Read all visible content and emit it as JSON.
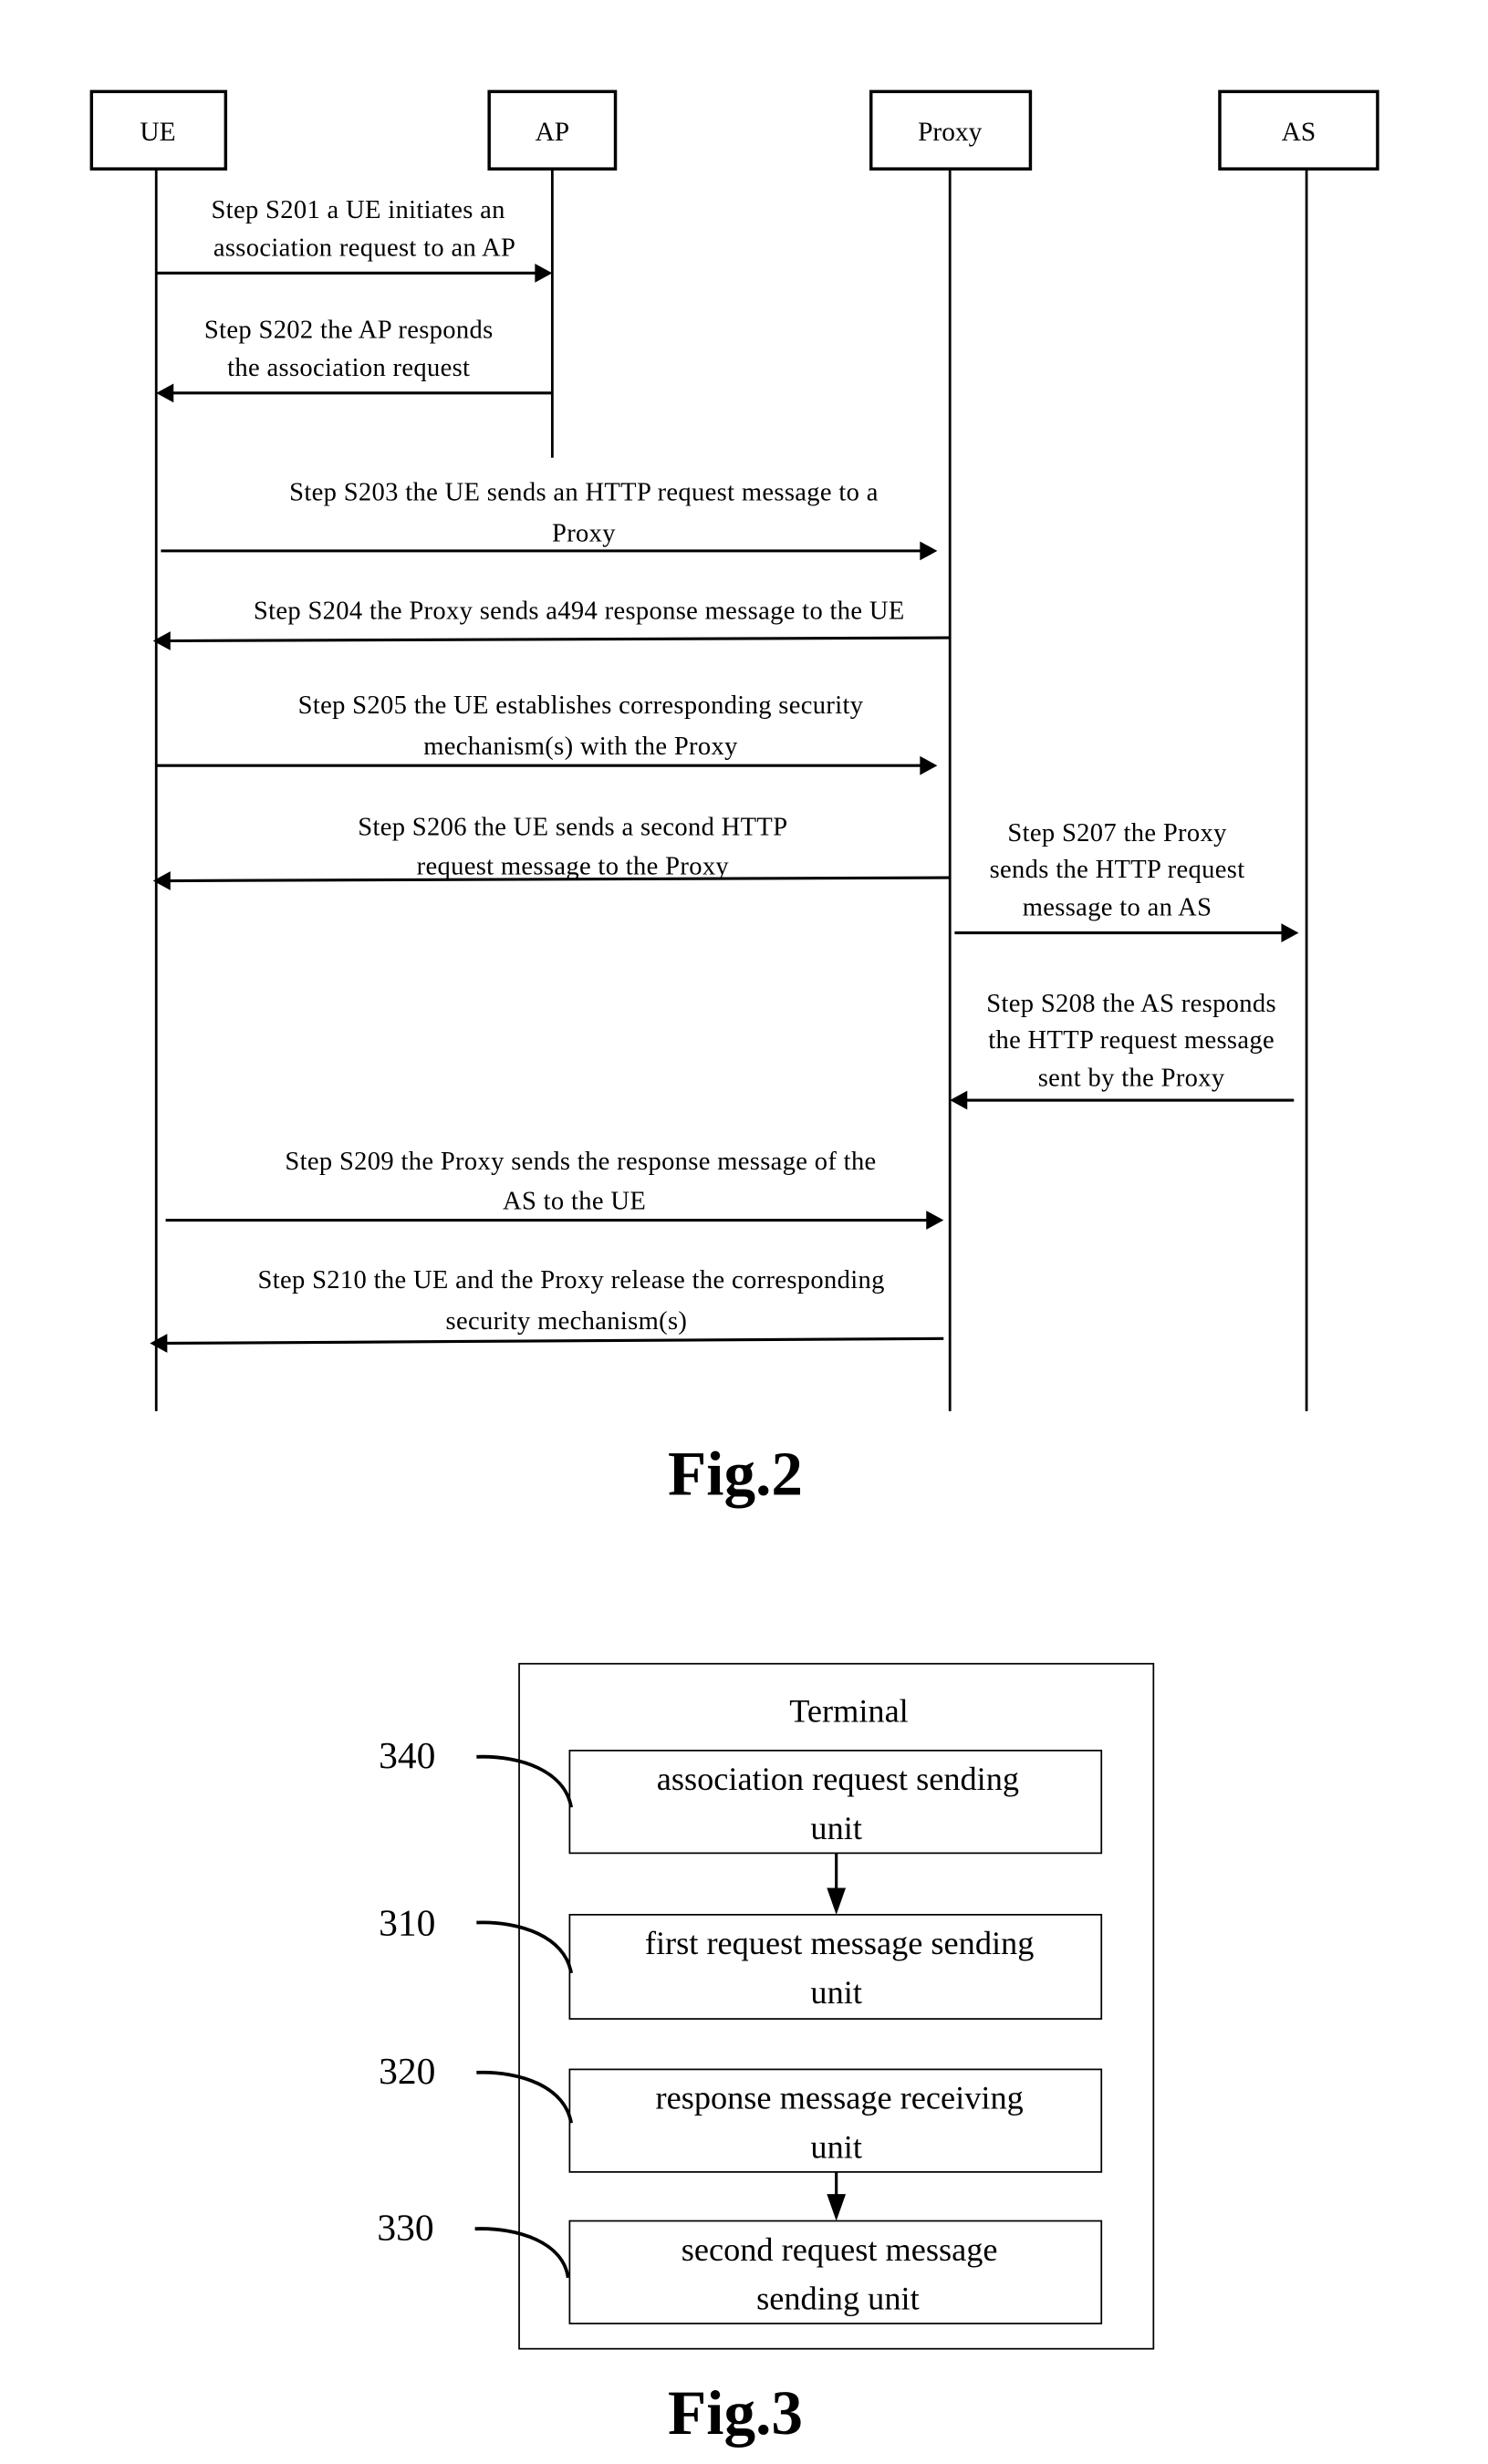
{
  "fig2": {
    "caption": "Fig.2",
    "actors": [
      {
        "id": "ue",
        "label": "UE"
      },
      {
        "id": "ap",
        "label": "AP"
      },
      {
        "id": "proxy",
        "label": "Proxy"
      },
      {
        "id": "as",
        "label": "AS"
      }
    ],
    "messages": [
      {
        "step": "S201",
        "from": "ue",
        "to": "ap",
        "lines": [
          "Step S201 a UE initiates an",
          "association request to an AP"
        ]
      },
      {
        "step": "S202",
        "from": "ap",
        "to": "ue",
        "lines": [
          "Step S202 the AP responds",
          "the association request"
        ]
      },
      {
        "step": "S203",
        "from": "ue",
        "to": "proxy",
        "lines": [
          "Step S203 the UE sends an HTTP request message to a",
          "Proxy"
        ]
      },
      {
        "step": "S204",
        "from": "proxy",
        "to": "ue",
        "lines": [
          "Step S204 the Proxy sends a494 response message to the UE"
        ]
      },
      {
        "step": "S205",
        "from": "ue",
        "to": "proxy",
        "lines": [
          "Step S205 the UE establishes corresponding security",
          "mechanism(s) with the Proxy"
        ]
      },
      {
        "step": "S206",
        "from": "proxy",
        "to": "ue",
        "lines": [
          "Step S206 the UE sends a second HTTP",
          "request message to the Proxy"
        ]
      },
      {
        "step": "S207",
        "from": "proxy",
        "to": "as",
        "lines": [
          "Step S207 the Proxy",
          "sends the HTTP request",
          "message to an AS"
        ]
      },
      {
        "step": "S208",
        "from": "as",
        "to": "proxy",
        "lines": [
          "Step S208 the AS responds",
          "the HTTP request message",
          "sent by the Proxy"
        ]
      },
      {
        "step": "S209",
        "from": "ue",
        "to": "proxy",
        "lines": [
          "Step S209 the Proxy sends the response message of the",
          "AS to the UE"
        ]
      },
      {
        "step": "S210",
        "from": "proxy",
        "to": "ue",
        "lines": [
          "Step S210 the UE and the Proxy release the corresponding",
          "security mechanism(s)"
        ]
      }
    ]
  },
  "fig3": {
    "caption": "Fig.3",
    "container_label": "Terminal",
    "units": [
      {
        "ref": "340",
        "lines": [
          "association request sending",
          "unit"
        ]
      },
      {
        "ref": "310",
        "lines": [
          "first request message sending",
          "unit"
        ]
      },
      {
        "ref": "320",
        "lines": [
          "response message receiving",
          "unit"
        ]
      },
      {
        "ref": "330",
        "lines": [
          "second request message",
          "sending unit"
        ]
      }
    ]
  }
}
